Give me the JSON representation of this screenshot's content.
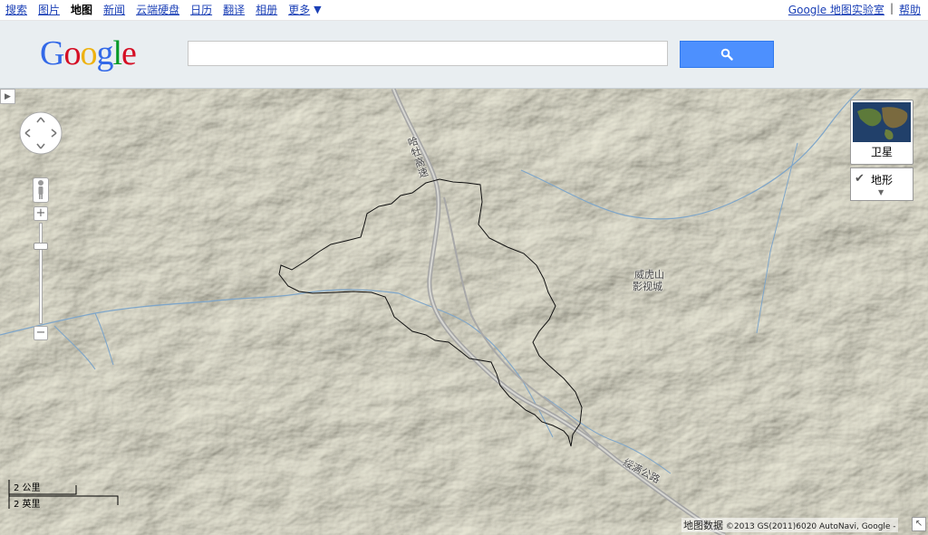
{
  "nav": {
    "items": [
      "搜索",
      "图片",
      "地图",
      "新闻",
      "云端硬盘",
      "日历",
      "翻译",
      "相册",
      "更多"
    ],
    "active": "地图",
    "more_arrow": "▼",
    "labs_link": "Google 地图实验室",
    "separator": "|",
    "help_link": "帮助"
  },
  "header": {
    "logo_letters": [
      "G",
      "o",
      "o",
      "g",
      "l",
      "e"
    ],
    "logo_colors": [
      "#3369e8",
      "#d50f25",
      "#eeb211",
      "#3369e8",
      "#009925",
      "#d50f25"
    ],
    "search_value": "",
    "search_icon": "search-icon"
  },
  "map": {
    "map_type_satellite": "卫星",
    "map_type_terrain": "地形",
    "terrain_checked": true,
    "road_labels": [
      "哈牡高速",
      "绥满公路"
    ],
    "place_labels": [
      "威虎山",
      "影视城"
    ],
    "scale_km": "2 公里",
    "scale_mi": "2 英里",
    "attribution_data": "地图数据",
    "attribution_text": "©2013 GS(2011)6020 AutoNavi, Google -",
    "colors": {
      "terrain_base": "#e4e3d9",
      "terrain_shade": "#b7b7a8",
      "river": "#7fa6c9",
      "highway": "#9a9a9a",
      "boundary": "#111111"
    }
  }
}
